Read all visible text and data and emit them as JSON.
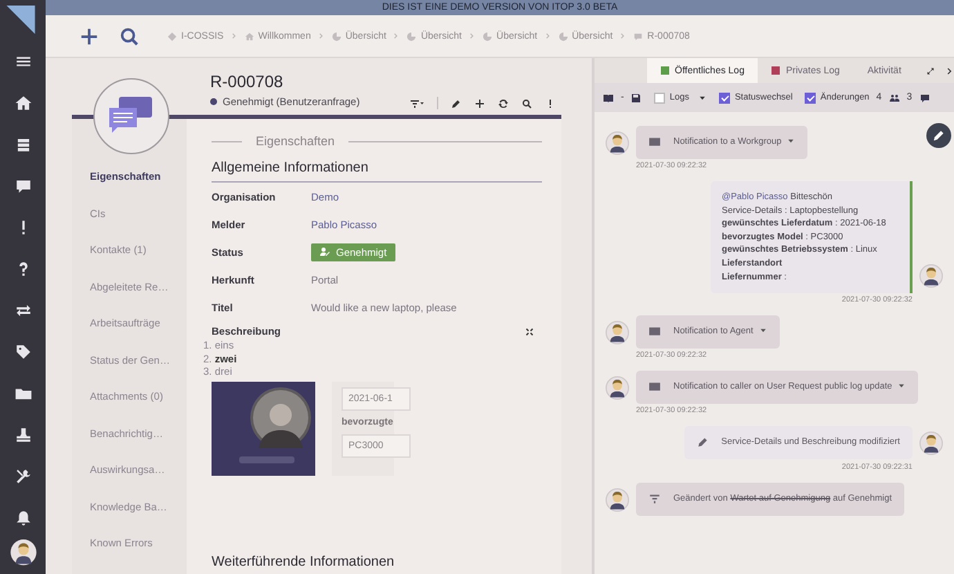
{
  "banner": "DIES IST EINE DEMO VERSION VON ITOP 3.0 BETA",
  "breadcrumbs": [
    {
      "kind": "organization",
      "label": "I-COSSIS"
    },
    {
      "kind": "home",
      "label": "Willkommen"
    },
    {
      "kind": "dashboard",
      "label": "Übersicht"
    },
    {
      "kind": "dashboard",
      "label": "Übersicht"
    },
    {
      "kind": "dashboard",
      "label": "Übersicht"
    },
    {
      "kind": "dashboard",
      "label": "Übersicht"
    },
    {
      "kind": "request",
      "label": "R-000708"
    }
  ],
  "object": {
    "ref": "R-000708",
    "status": "Genehmigt (Benutzeranfrage)"
  },
  "tabs": [
    {
      "label": "Eigenschaften",
      "selected": true
    },
    {
      "label": "CIs",
      "selected": false
    },
    {
      "label": "Kontakte (1)",
      "selected": false
    },
    {
      "label": "Abgeleitete Re…",
      "selected": false
    },
    {
      "label": "Arbeitsaufträge",
      "selected": false
    },
    {
      "label": "Status der Gen…",
      "selected": false
    },
    {
      "label": "Attachments (0)",
      "selected": false
    },
    {
      "label": "Benachrichtig…",
      "selected": false
    },
    {
      "label": "Auswirkungsa…",
      "selected": false
    },
    {
      "label": "Knowledge Ba…",
      "selected": false
    },
    {
      "label": "Known Errors",
      "selected": false
    }
  ],
  "section_title": "Eigenschaften",
  "group_title": "Allgemeine Informationen",
  "fields": [
    {
      "label": "Organisation",
      "value": "Demo",
      "kind": "link"
    },
    {
      "label": "Melder",
      "value": "Pablo Picasso",
      "kind": "link"
    },
    {
      "label": "Status",
      "value": "Genehmigt",
      "kind": "badge"
    },
    {
      "label": "Herkunft",
      "value": "Portal",
      "kind": "text"
    },
    {
      "label": "Titel",
      "value": "Would like a new laptop, please",
      "kind": "text"
    }
  ],
  "description": {
    "label": "Beschreibung",
    "items": [
      {
        "marker": "1.",
        "text": "eins",
        "bold": false
      },
      {
        "marker": "2.",
        "text": "zwei",
        "bold": true
      },
      {
        "marker": "3.",
        "text": "drei",
        "bold": false
      }
    ],
    "date_value": "2021-06-1",
    "model_label": "bevorzugte",
    "model_value": "PC3000"
  },
  "next_group_title": "Weiterführende Informationen",
  "log": {
    "tabs": [
      {
        "label": "Öffentliches Log",
        "selected": true,
        "color": "#5e9e4a"
      },
      {
        "label": "Privates Log",
        "selected": false,
        "color": "#b0405a"
      },
      {
        "label": "Aktivität",
        "selected": false
      }
    ],
    "filters": [
      {
        "label": "Logs",
        "checked": false,
        "dropdown": true
      },
      {
        "label": "Statuswechsel",
        "checked": true,
        "dropdown": false
      },
      {
        "label": "Änderungen",
        "checked": true,
        "dropdown": false
      }
    ],
    "view_separator": "-",
    "participants": "4",
    "messages": "3",
    "entries": [
      {
        "kind": "notification",
        "text": "Notification to a Workgroup",
        "time": "2021-07-30 09:22:32"
      },
      {
        "kind": "message",
        "mention": "@Pablo Picasso",
        "text": "Bitteschön",
        "lines": [
          "Service-Details : Laptopbestellung",
          "**gewünschtes Lieferdatum** : 2021-06-18",
          "**bevorzugtes Model** : PC3000",
          "**gewünschtes Betriebssystem** : Linux",
          "**Lieferstandort**",
          "**Liefernummer** :"
        ],
        "time": "2021-07-30 09:22:32"
      },
      {
        "kind": "notification",
        "text": "Notification to Agent",
        "time": "2021-07-30 09:22:32"
      },
      {
        "kind": "notification",
        "text": "Notification to caller on User Request public log update",
        "time": "2021-07-30 09:22:32"
      },
      {
        "kind": "change",
        "text": "Service-Details und Beschreibung modifiziert",
        "time": "2021-07-30 09:22:31"
      },
      {
        "kind": "state",
        "prefix": "Geändert von",
        "old": "Wartet auf Genehmigung",
        "middle": "auf",
        "new": "Genehmigt"
      }
    ]
  }
}
